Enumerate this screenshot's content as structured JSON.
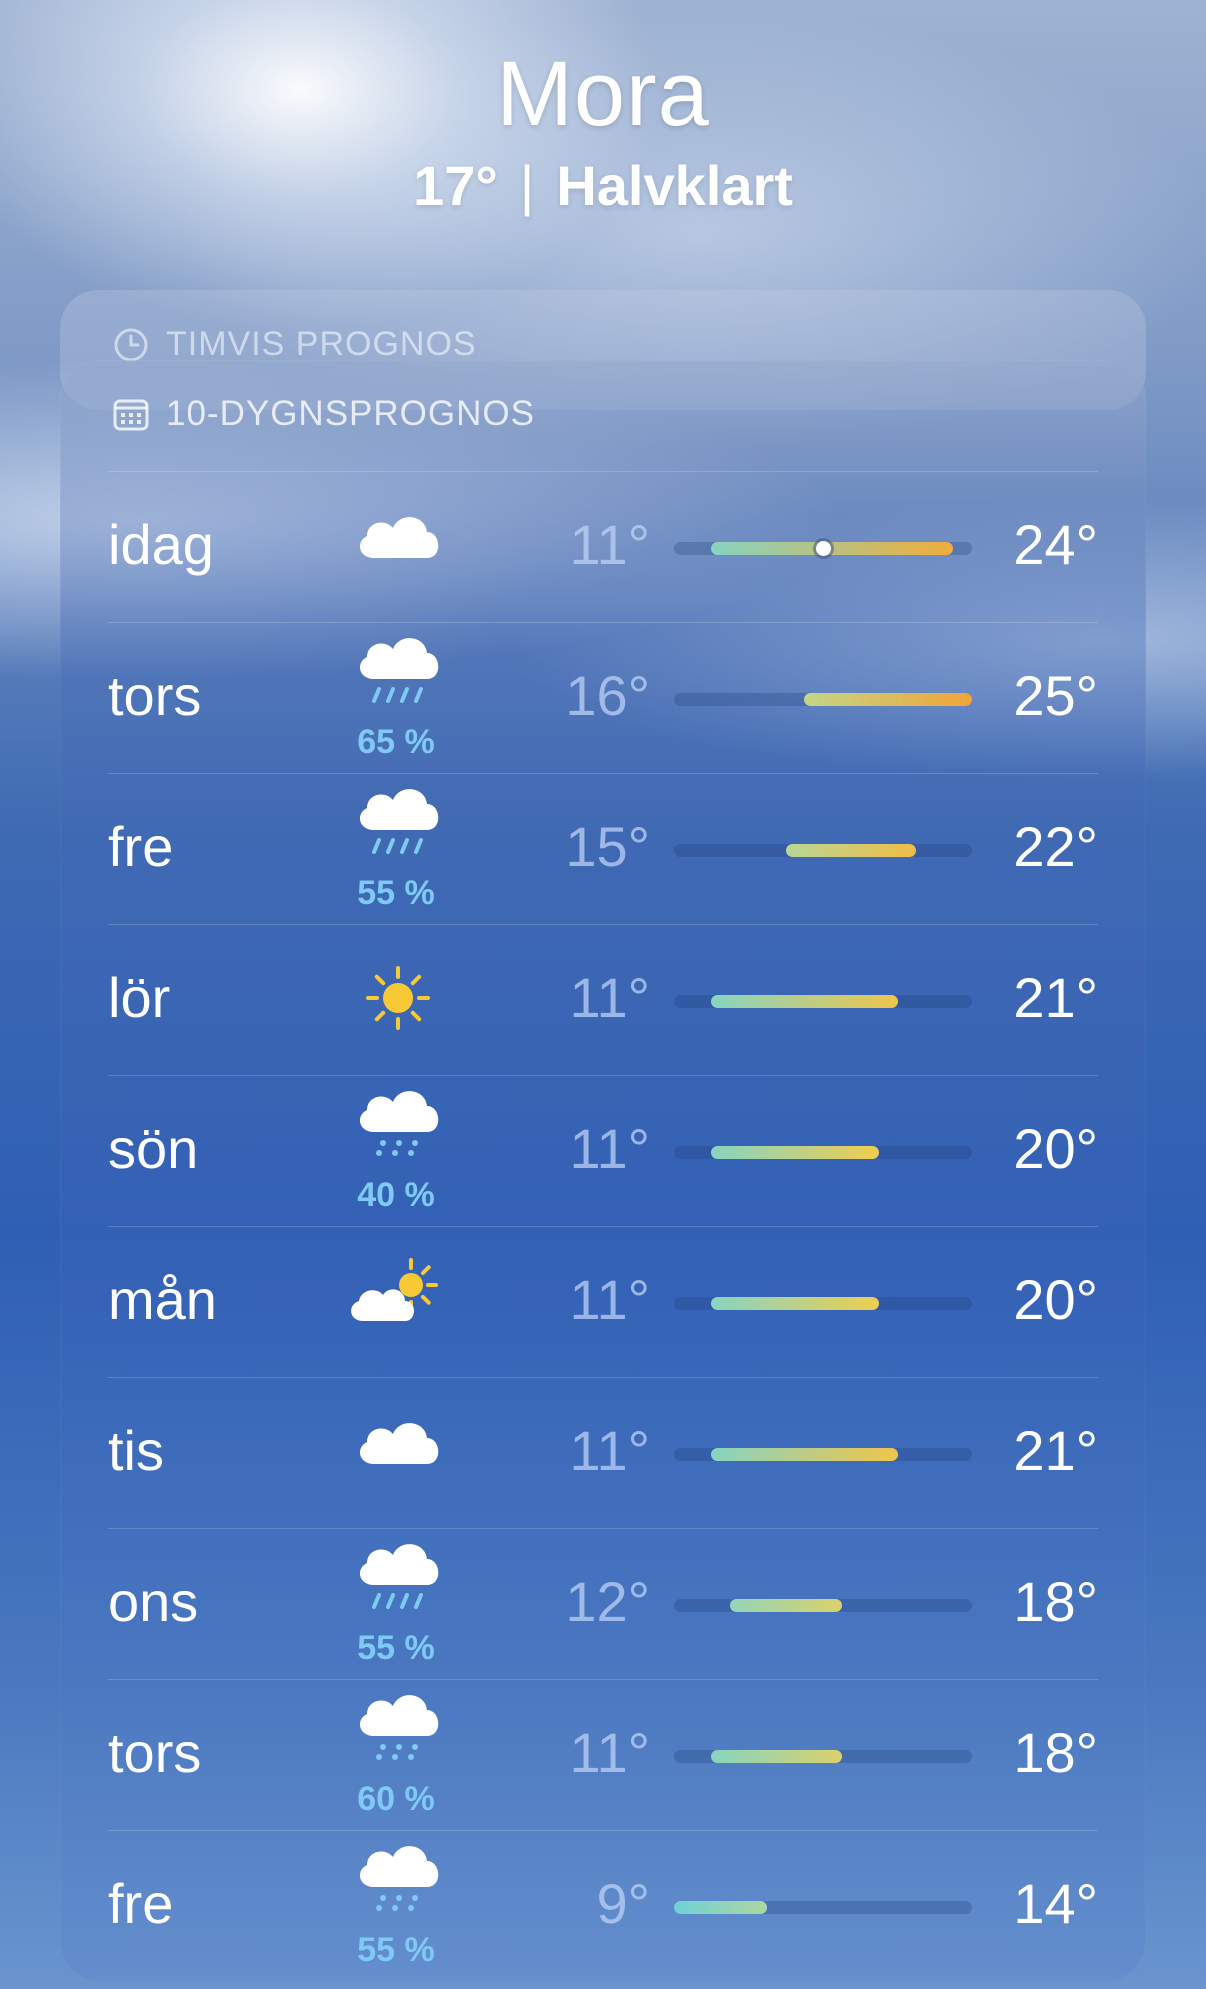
{
  "location": {
    "city": "Mora",
    "temp": "17°",
    "separator": "|",
    "condition": "Halvklart"
  },
  "hourly": {
    "label": "TIMVIS PROGNOS"
  },
  "forecast": {
    "label": "10-DYGNSPROGNOS",
    "range_min": 9,
    "range_max": 25,
    "current_temp": 17,
    "days": [
      {
        "day": "idag",
        "icon": "cloud-icon",
        "precip": "",
        "low": "11°",
        "high": "24°",
        "lo": 11,
        "hi": 24,
        "now": true
      },
      {
        "day": "tors",
        "icon": "cloud-rain-icon",
        "precip": "65 %",
        "low": "16°",
        "high": "25°",
        "lo": 16,
        "hi": 25
      },
      {
        "day": "fre",
        "icon": "cloud-rain-icon",
        "precip": "55 %",
        "low": "15°",
        "high": "22°",
        "lo": 15,
        "hi": 22
      },
      {
        "day": "lör",
        "icon": "sun-icon",
        "precip": "",
        "low": "11°",
        "high": "21°",
        "lo": 11,
        "hi": 21
      },
      {
        "day": "sön",
        "icon": "cloud-drizzle-icon",
        "precip": "40 %",
        "low": "11°",
        "high": "20°",
        "lo": 11,
        "hi": 20
      },
      {
        "day": "mån",
        "icon": "sun-cloud-icon",
        "precip": "",
        "low": "11°",
        "high": "20°",
        "lo": 11,
        "hi": 20
      },
      {
        "day": "tis",
        "icon": "cloud-icon",
        "precip": "",
        "low": "11°",
        "high": "21°",
        "lo": 11,
        "hi": 21
      },
      {
        "day": "ons",
        "icon": "cloud-rain-icon",
        "precip": "55 %",
        "low": "12°",
        "high": "18°",
        "lo": 12,
        "hi": 18
      },
      {
        "day": "tors",
        "icon": "cloud-drizzle-icon",
        "precip": "60 %",
        "low": "11°",
        "high": "18°",
        "lo": 11,
        "hi": 18
      },
      {
        "day": "fre",
        "icon": "cloud-drizzle-icon",
        "precip": "55 %",
        "low": "9°",
        "high": "14°",
        "lo": 9,
        "hi": 14
      }
    ]
  }
}
